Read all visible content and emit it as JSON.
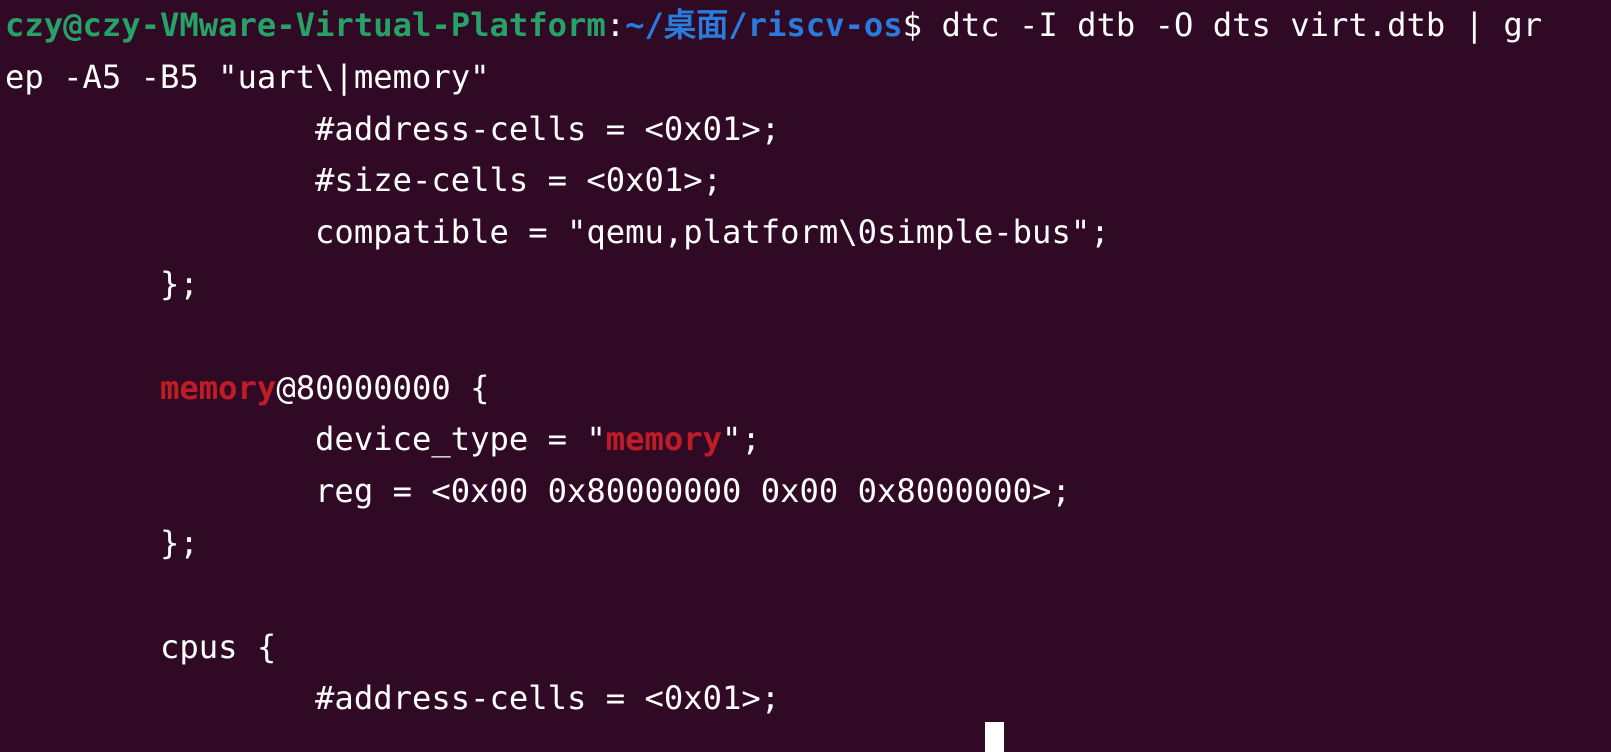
{
  "prompt": {
    "user_host": "czy@czy-VMware-Virtual-Platform",
    "colon": ":",
    "path": "~/桌面/riscv-os",
    "dollar": "$",
    "command_part1": " dtc -I dtb -O dts virt.dtb | gr",
    "command_part2": "ep -A5 -B5 \"uart\\|memory\""
  },
  "output": {
    "line1": "                #address-cells = <0x01>;",
    "line2": "                #size-cells = <0x01>;",
    "line3": "                compatible = \"qemu,platform\\0simple-bus\";",
    "line4": "        };",
    "line5": "",
    "line6_indent": "        ",
    "line6_match": "memory",
    "line6_rest": "@80000000 {",
    "line7_pre": "                device_type = \"",
    "line7_match": "memory",
    "line7_post": "\";",
    "line8": "                reg = <0x00 0x80000000 0x00 0x8000000>;",
    "line9": "        };",
    "line10": "",
    "line11": "        cpus {",
    "line12": "                #address-cells = <0x01>;"
  },
  "colors": {
    "background": "#300a24",
    "prompt_user": "#26a269",
    "prompt_path": "#2a7bde",
    "grep_match": "#c01c28",
    "text": "#ffffff"
  }
}
